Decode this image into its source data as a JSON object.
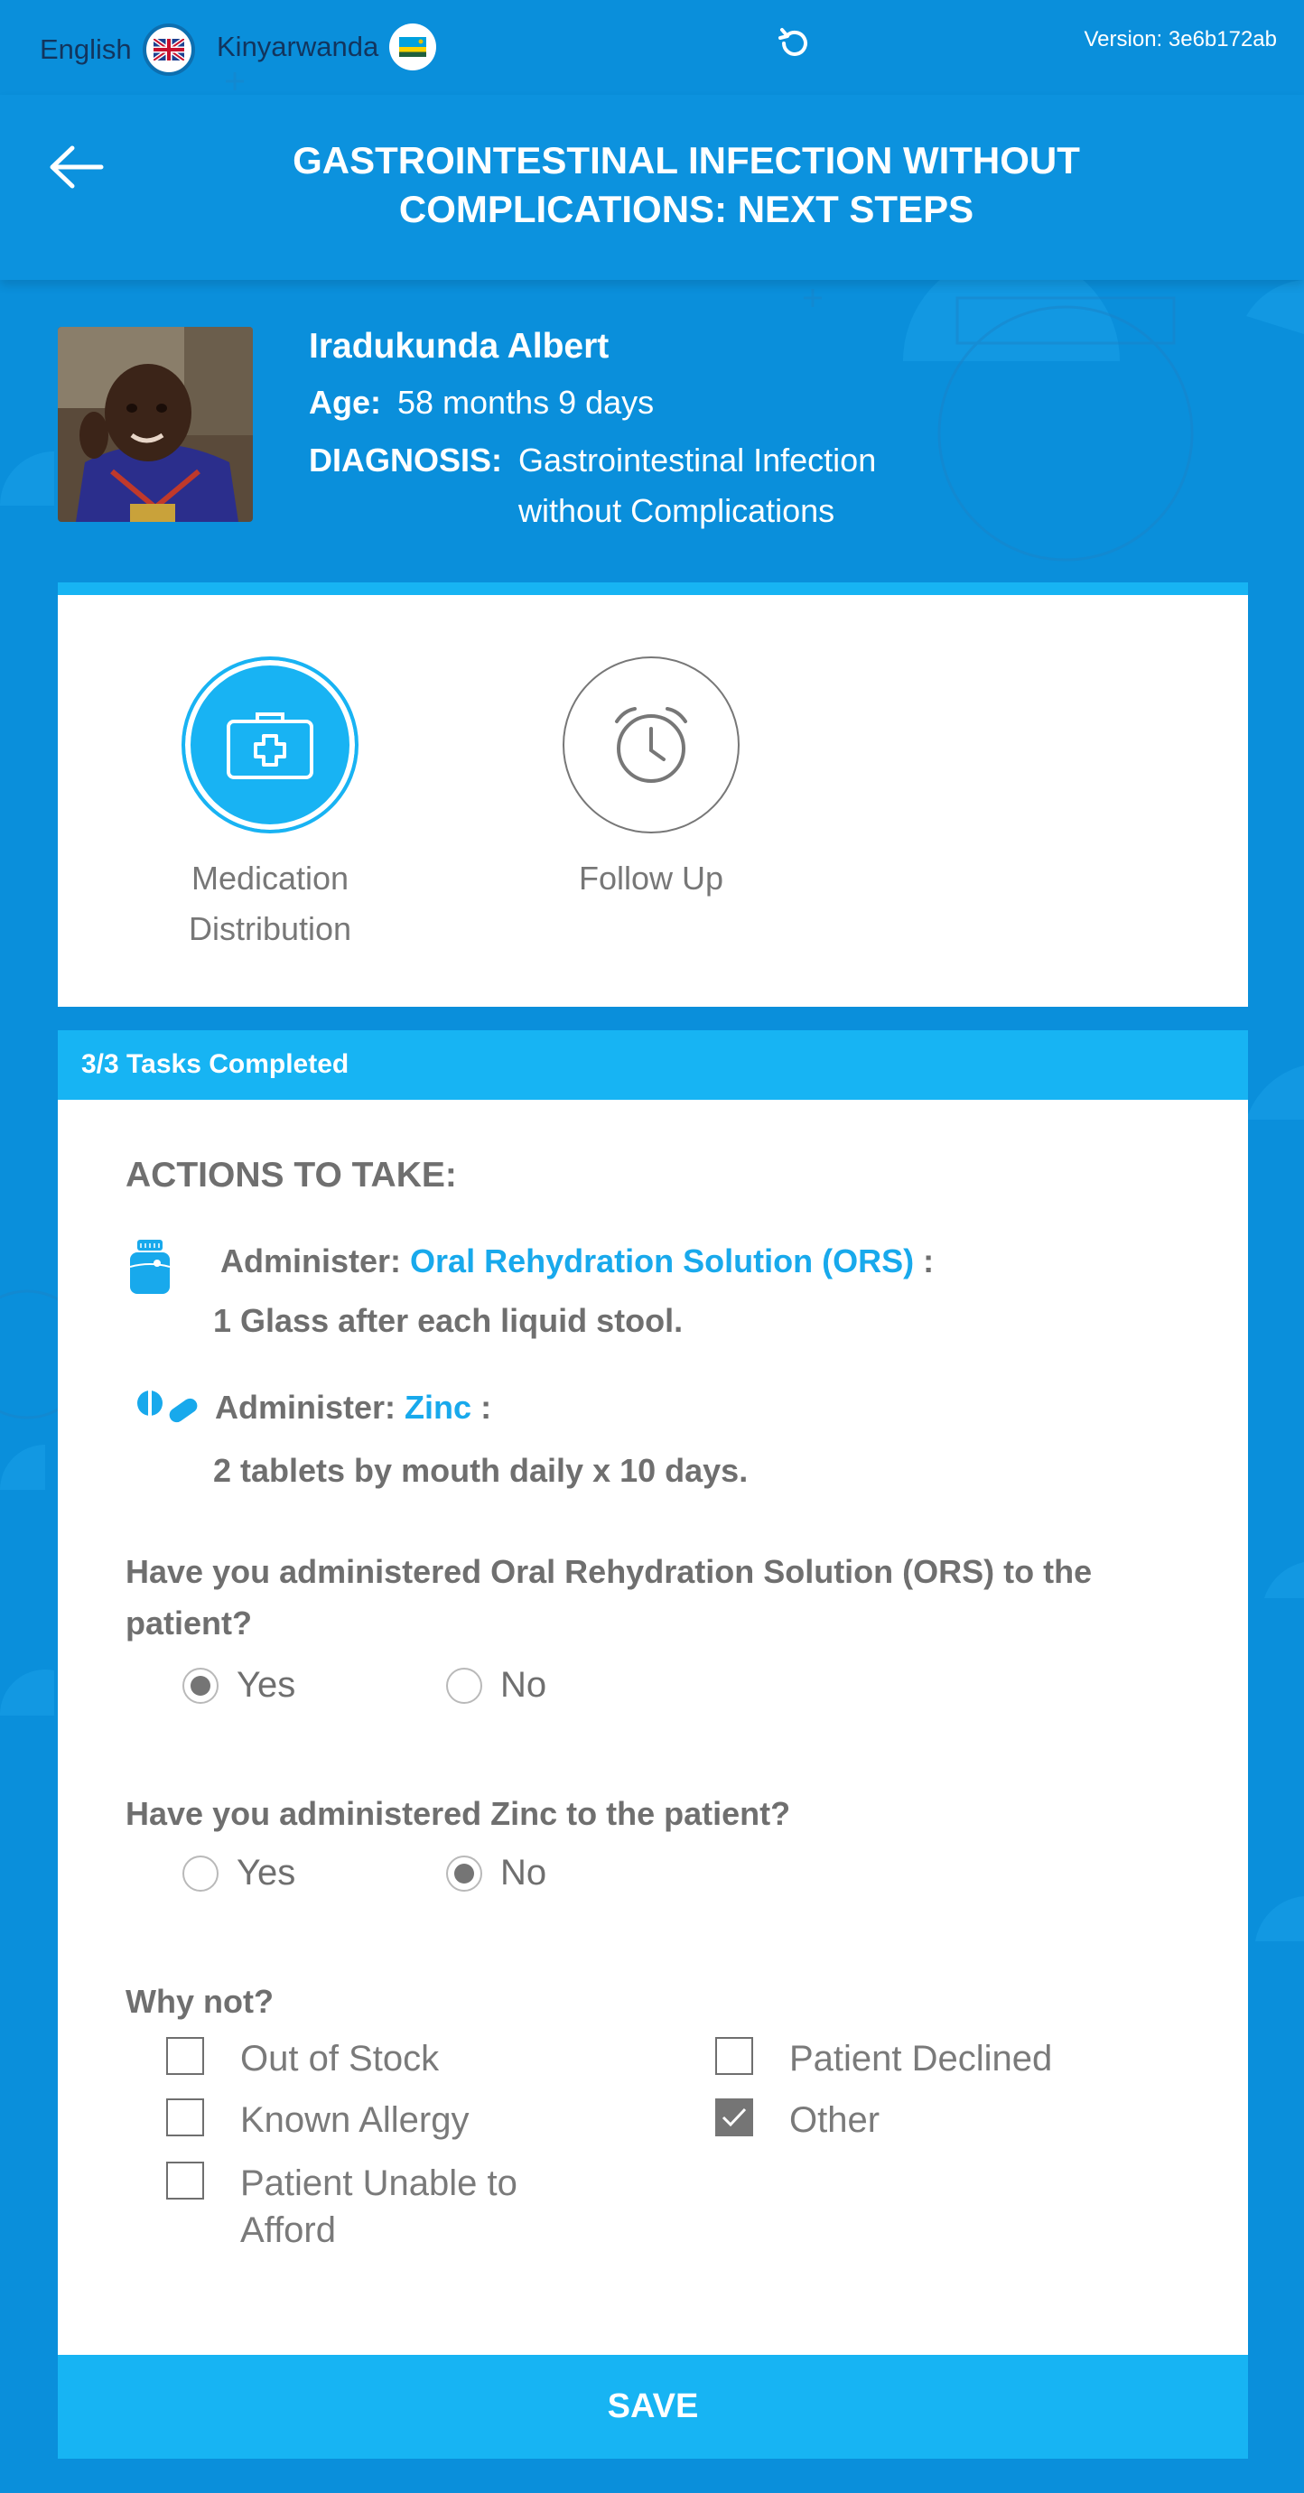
{
  "topbar": {
    "lang_english": "English",
    "lang_kinyarwanda": "Kinyarwanda",
    "version": "Version: 3e6b172ab",
    "refresh_icon": "refresh-icon",
    "flag_uk_icon": "uk-flag-icon",
    "flag_rw_icon": "rwanda-flag-icon"
  },
  "header": {
    "title_line1": "GASTROINTESTINAL INFECTION WITHOUT",
    "title_line2": "COMPLICATIONS: NEXT STEPS",
    "back_icon": "back-arrow-icon"
  },
  "patient": {
    "name": "Iradukunda Albert",
    "age_label": "Age:",
    "age_value": "58 months 9 days",
    "diagnosis_label": "DIAGNOSIS:",
    "diagnosis_line1": "Gastrointestinal Infection",
    "diagnosis_line2": "without Complications"
  },
  "steps": [
    {
      "label_line1": "Medication",
      "label_line2": "Distribution",
      "icon": "medical-kit-icon",
      "active": true
    },
    {
      "label_line1": "Follow Up",
      "label_line2": "",
      "icon": "alarm-clock-icon",
      "active": false
    }
  ],
  "tasks": {
    "status": "3/3 Tasks Completed"
  },
  "actions": {
    "heading": "ACTIONS TO TAKE:",
    "items": [
      {
        "prefix": "Administer:",
        "drug": "Oral Rehydration Solution (ORS)",
        "suffix": ":",
        "instruction": "1 Glass after each liquid stool.",
        "icon": "ors-bottle-icon"
      },
      {
        "prefix": "Administer:",
        "drug": "Zinc",
        "suffix": ":",
        "instruction": "2 tablets by mouth daily x 10 days.",
        "icon": "pills-icon"
      }
    ]
  },
  "questions": [
    {
      "line1": "Have you administered Oral Rehydration Solution (ORS) to the",
      "line2": "patient?",
      "options": [
        "Yes",
        "No"
      ],
      "selected": "Yes"
    },
    {
      "line1": "Have you administered Zinc to the patient?",
      "options": [
        "Yes",
        "No"
      ],
      "selected": "No"
    }
  ],
  "why_not": {
    "label": "Why not?",
    "options": [
      {
        "label": "Out of Stock",
        "checked": false
      },
      {
        "label": "Patient Declined",
        "checked": false
      },
      {
        "label": "Known Allergy",
        "checked": false
      },
      {
        "label": "Other",
        "checked": true
      },
      {
        "label_line1": "Patient Unable to",
        "label_line2": "Afford",
        "checked": false
      }
    ]
  },
  "save": {
    "label": "SAVE"
  },
  "colors": {
    "primary": "#0a8fdb",
    "accent": "#17b4f3",
    "text_gray": "#6f6f6f",
    "drug_blue": "#18a9ec"
  }
}
